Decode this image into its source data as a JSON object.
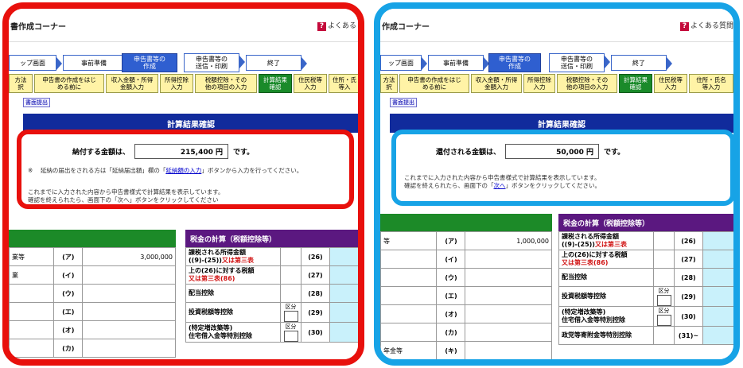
{
  "left": {
    "title": "書作成コーナー",
    "help": "よくある",
    "help_glyph": "?",
    "steps": [
      "ップ画面",
      "事前準備",
      "申告書等の\n作成",
      "申告書等の\n送信・印刷",
      "終了"
    ],
    "tabs": [
      "方法\n択",
      "申告書の作成をはじ\nめる前に",
      "収入金額・所得\n金額入力",
      "所得控除\n入力",
      "税額控除・その\n他の項目の入力",
      "計算結果\n確認",
      "住民税等\n入力",
      "住所・氏\n等入"
    ],
    "small_button": "書面提出",
    "heading": "計算結果確認",
    "amount_label": "納付する金額は、",
    "amount_value": "215,400 円",
    "amount_suffix": "です。",
    "note_mark": "※",
    "note_pre": "延納の届出をされる方は「延納届出額」欄の「",
    "note_link": "延納額の入力",
    "note_post": "」ボタンから入力を行ってください。",
    "msg1": "これまでに入力された内容から申告書様式で計算結果を表示しています。",
    "msg2": "確認を終えられたら、画面下の「次へ」ボタンをクリックしてください",
    "tax_title": "税金の計算（税額控除等）",
    "left_rows": [
      {
        "label": "業等",
        "code": "(ア)",
        "value": "3,000,000"
      },
      {
        "label": "業",
        "code": "(イ)",
        "value": ""
      },
      {
        "label": "",
        "code": "(ウ)",
        "value": ""
      },
      {
        "label": "",
        "code": "(エ)",
        "value": ""
      },
      {
        "label": "",
        "code": "(オ)",
        "value": ""
      },
      {
        "label": "",
        "code": "(カ)",
        "value": ""
      }
    ],
    "right_rows": [
      {
        "label": "課税される所得金額\n((9)-(25))",
        "red": "又は第三表",
        "code": "(26)",
        "kubun": false
      },
      {
        "label": "上の(26)に対する税額\n",
        "red": "又は第三表(86)",
        "code": "(27)",
        "kubun": false
      },
      {
        "label": "配当控除",
        "red": "",
        "code": "(28)",
        "kubun": false
      },
      {
        "label": "投資税額等控除",
        "red": "",
        "code": "(29)",
        "kubun": true
      },
      {
        "label": "(特定増改築等)\n住宅借入金等特別控除",
        "red": "",
        "code": "(30)",
        "kubun": true
      }
    ],
    "kubun_label": "区分"
  },
  "right": {
    "title": "作成コーナー",
    "help": "よくある質問",
    "help_glyph": "?",
    "steps": [
      "ップ画面",
      "事前準備",
      "申告書等の\n作成",
      "申告書等の\n送信・印刷",
      "終了"
    ],
    "tabs": [
      "方法\n択",
      "申告書の作成をはじ\nめる前に",
      "収入金額・所得\n金額入力",
      "所得控除\n入力",
      "税額控除・その\n他の項目の入力",
      "計算結果\n確認",
      "住民税等\n入力",
      "住所・氏名\n等入力"
    ],
    "small_button": "書面提出",
    "heading": "計算結果確認",
    "amount_label": "還付される金額は、",
    "amount_value": "50,000 円",
    "amount_suffix": "です。",
    "msg1": "これまでに入力された内容から申告書様式で計算結果を表示しています。",
    "msg2_pre": "確認を終えられたら、画面下の「",
    "msg2_link": "次へ",
    "msg2_post": "」ボタンをクリックしてください。",
    "tax_title": "税金の計算（税額控除等）",
    "left_rows": [
      {
        "label": "等",
        "code": "(ア)",
        "value": "1,000,000"
      },
      {
        "label": "",
        "code": "(イ)",
        "value": ""
      },
      {
        "label": "",
        "code": "(ウ)",
        "value": ""
      },
      {
        "label": "",
        "code": "(エ)",
        "value": ""
      },
      {
        "label": "",
        "code": "(オ)",
        "value": ""
      },
      {
        "label": "",
        "code": "(カ)",
        "value": ""
      },
      {
        "label": "年金等",
        "code": "(キ)",
        "value": ""
      }
    ],
    "right_rows": [
      {
        "label": "課税される所得金額\n((9)-(25))",
        "red": "又は第三表",
        "code": "(26)",
        "kubun": false
      },
      {
        "label": "上の(26)に対する税額\n",
        "red": "又は第三表(86)",
        "code": "(27)",
        "kubun": false
      },
      {
        "label": "配当控除",
        "red": "",
        "code": "(28)",
        "kubun": false
      },
      {
        "label": "投資税額等控除",
        "red": "",
        "code": "(29)",
        "kubun": true
      },
      {
        "label": "(特定増改築等)\n住宅借入金等特別控除",
        "red": "",
        "code": "(30)",
        "kubun": true
      },
      {
        "label": "政党等寄附金等特別控除",
        "red": "",
        "code": "(31)~",
        "kubun": false
      }
    ],
    "kubun_label": "区分"
  }
}
